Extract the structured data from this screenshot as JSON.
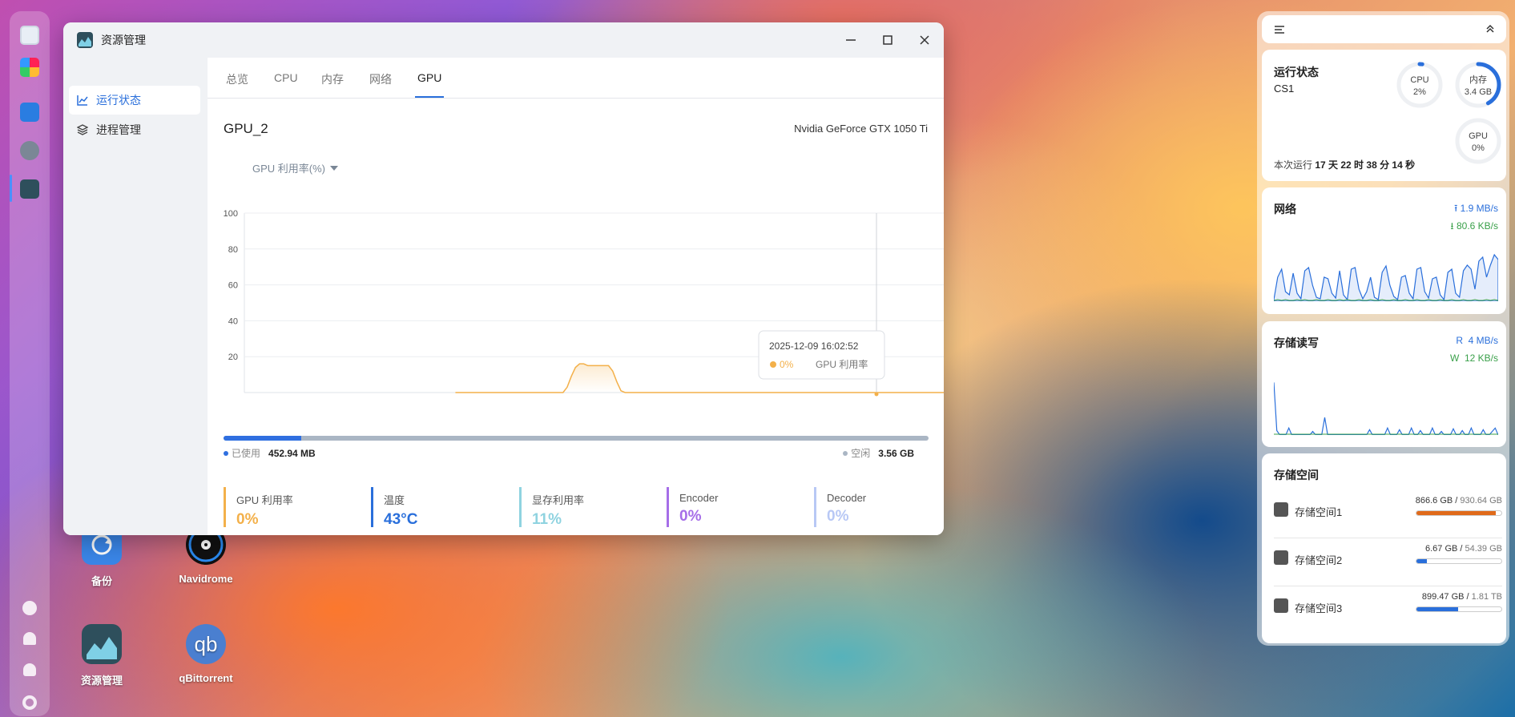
{
  "window": {
    "title": "资源管理",
    "sidebar": [
      {
        "label": "运行状态",
        "active": true,
        "icon": "line-chart-icon"
      },
      {
        "label": "进程管理",
        "active": false,
        "icon": "layers-icon"
      }
    ],
    "tabs": [
      {
        "label": "总览",
        "active": false
      },
      {
        "label": "CPU",
        "active": false
      },
      {
        "label": "内存",
        "active": false
      },
      {
        "label": "网络",
        "active": false
      },
      {
        "label": "GPU",
        "active": true
      }
    ],
    "gpu_name": "GPU_2",
    "gpu_model": "Nvidia GeForce GTX 1050 Ti",
    "metric_select": "GPU 利用率(%)",
    "tooltip": {
      "time": "2025-12-09 16:02:52",
      "value": "0%",
      "label": "GPU 利用率"
    },
    "memory": {
      "used_label": "已使用",
      "used": "452.94 MB",
      "free_label": "空闲",
      "free": "3.56 GB",
      "used_fraction": 0.11
    },
    "stats": [
      {
        "label": "GPU 利用率",
        "value": "0%",
        "color": "#f3b04a"
      },
      {
        "label": "温度",
        "value": "43°C",
        "color": "#2a6fdb"
      },
      {
        "label": "显存利用率",
        "value": "11%",
        "color": "#8fd3e0"
      },
      {
        "label": "Encoder",
        "value": "0%",
        "color": "#a66ee8"
      },
      {
        "label": "Decoder",
        "value": "0%",
        "color": "#b8c8f5"
      }
    ]
  },
  "chart_data": {
    "type": "area",
    "title": "",
    "ylabel": "GPU 利用率(%)",
    "ylim": [
      0,
      100
    ],
    "yticks": [
      20,
      40,
      60,
      80,
      100
    ],
    "series": [
      {
        "name": "GPU 利用率",
        "color": "#f3b04a",
        "values": [
          null,
          null,
          null,
          null,
          null,
          null,
          null,
          null,
          null,
          null,
          null,
          null,
          null,
          null,
          null,
          null,
          null,
          null,
          null,
          null,
          null,
          null,
          null,
          null,
          null,
          null,
          null,
          null,
          null,
          null,
          null,
          null,
          null,
          null,
          null,
          null,
          null,
          null,
          null,
          null,
          null,
          null,
          null,
          null,
          null,
          null,
          null,
          null,
          null,
          null,
          null,
          0,
          0,
          0,
          0,
          0,
          0,
          0,
          0,
          0,
          0,
          0,
          0,
          0,
          0,
          0,
          0,
          0,
          0,
          0,
          0,
          0,
          0,
          0,
          0,
          0,
          0,
          0,
          3,
          9,
          14,
          16,
          16,
          15,
          15,
          15,
          15,
          15,
          15,
          12,
          6,
          1,
          0,
          0,
          0,
          0,
          0,
          0,
          0,
          0,
          0,
          0,
          0,
          0,
          0,
          0,
          0,
          0,
          0,
          0,
          0,
          0,
          0,
          0,
          0,
          0,
          0,
          0,
          0,
          0,
          0,
          0,
          0,
          0,
          0,
          0,
          0,
          0,
          0,
          0,
          0,
          0,
          0,
          0,
          0,
          0,
          0,
          0,
          0,
          0,
          0,
          0,
          0,
          0,
          0,
          0,
          0,
          0,
          0,
          0,
          0,
          0,
          0,
          0,
          0,
          0,
          0,
          0,
          0,
          0,
          0,
          0,
          0,
          0,
          0,
          0,
          0,
          0,
          0,
          0
        ]
      }
    ]
  },
  "desktop_icons": [
    {
      "label": "备份",
      "color": "#3a86e8"
    },
    {
      "label": "Navidrome",
      "color": "#1a1a2e"
    },
    {
      "label": "资源管理",
      "color": "#2e4f5c"
    },
    {
      "label": "qBittorrent",
      "color": "#4a7fd0"
    }
  ],
  "panel": {
    "status": {
      "title": "运行状态",
      "host": "CS1",
      "cpu": {
        "label": "CPU",
        "value": "2%",
        "fraction": 0.02
      },
      "mem": {
        "label": "内存",
        "value": "3.4 GB",
        "fraction": 0.42
      },
      "gpu": {
        "label": "GPU",
        "value": "0%",
        "fraction": 0
      },
      "uptime_prefix": "本次运行",
      "uptime": "17 天 22 时 38 分 14 秒"
    },
    "network": {
      "title": "网络",
      "up": "1.9 MB/s",
      "down": "80.6 KB/s",
      "up_series": [
        2,
        30,
        40,
        12,
        8,
        35,
        10,
        3,
        38,
        42,
        20,
        5,
        3,
        30,
        28,
        10,
        4,
        38,
        8,
        2,
        40,
        42,
        15,
        3,
        12,
        30,
        5,
        2,
        36,
        44,
        20,
        6,
        2,
        30,
        32,
        10,
        3,
        40,
        42,
        12,
        4,
        28,
        30,
        8,
        2,
        36,
        40,
        10,
        5,
        38,
        45,
        40,
        15,
        50,
        55,
        30,
        45,
        58,
        52
      ],
      "down_series": [
        1,
        2,
        1,
        2,
        1,
        1,
        2,
        1,
        2,
        1,
        1,
        2,
        1,
        1,
        2,
        1,
        1,
        2,
        1,
        2,
        1,
        1,
        2,
        1,
        1,
        2,
        1,
        1,
        2,
        1,
        1,
        2,
        1,
        1,
        2,
        1,
        1,
        2,
        1,
        1,
        2,
        1,
        1,
        2,
        1,
        1,
        2,
        1,
        1,
        2,
        1,
        1,
        2,
        1,
        1,
        2,
        1,
        2,
        1
      ]
    },
    "storage_io": {
      "title": "存储读写",
      "r_label": "R",
      "r": "4 MB/s",
      "w_label": "W",
      "w": "12 KB/s",
      "series": [
        60,
        5,
        0,
        0,
        0,
        8,
        0,
        0,
        0,
        0,
        0,
        0,
        0,
        4,
        0,
        0,
        0,
        20,
        0,
        0,
        0,
        0,
        0,
        0,
        0,
        0,
        0,
        0,
        0,
        0,
        0,
        0,
        6,
        0,
        0,
        0,
        0,
        0,
        8,
        0,
        0,
        0,
        6,
        0,
        0,
        0,
        8,
        0,
        0,
        5,
        0,
        0,
        0,
        8,
        0,
        0,
        4,
        0,
        0,
        0,
        7,
        0,
        0,
        5,
        0,
        0,
        8,
        0,
        0,
        0,
        6,
        0,
        0,
        4,
        8,
        0
      ]
    },
    "storage": {
      "title": "存储空间",
      "items": [
        {
          "name": "存储空间1",
          "used": "866.6 GB",
          "total": "930.64 GB",
          "fraction": 0.93,
          "color": "#e06a1a"
        },
        {
          "name": "存储空间2",
          "used": "6.67 GB",
          "total": "54.39 GB",
          "fraction": 0.12,
          "color": "#2a6fdb"
        },
        {
          "name": "存储空间3",
          "used": "899.47 GB",
          "total": "1.81 TB",
          "fraction": 0.49,
          "color": "#2a6fdb"
        }
      ]
    }
  }
}
